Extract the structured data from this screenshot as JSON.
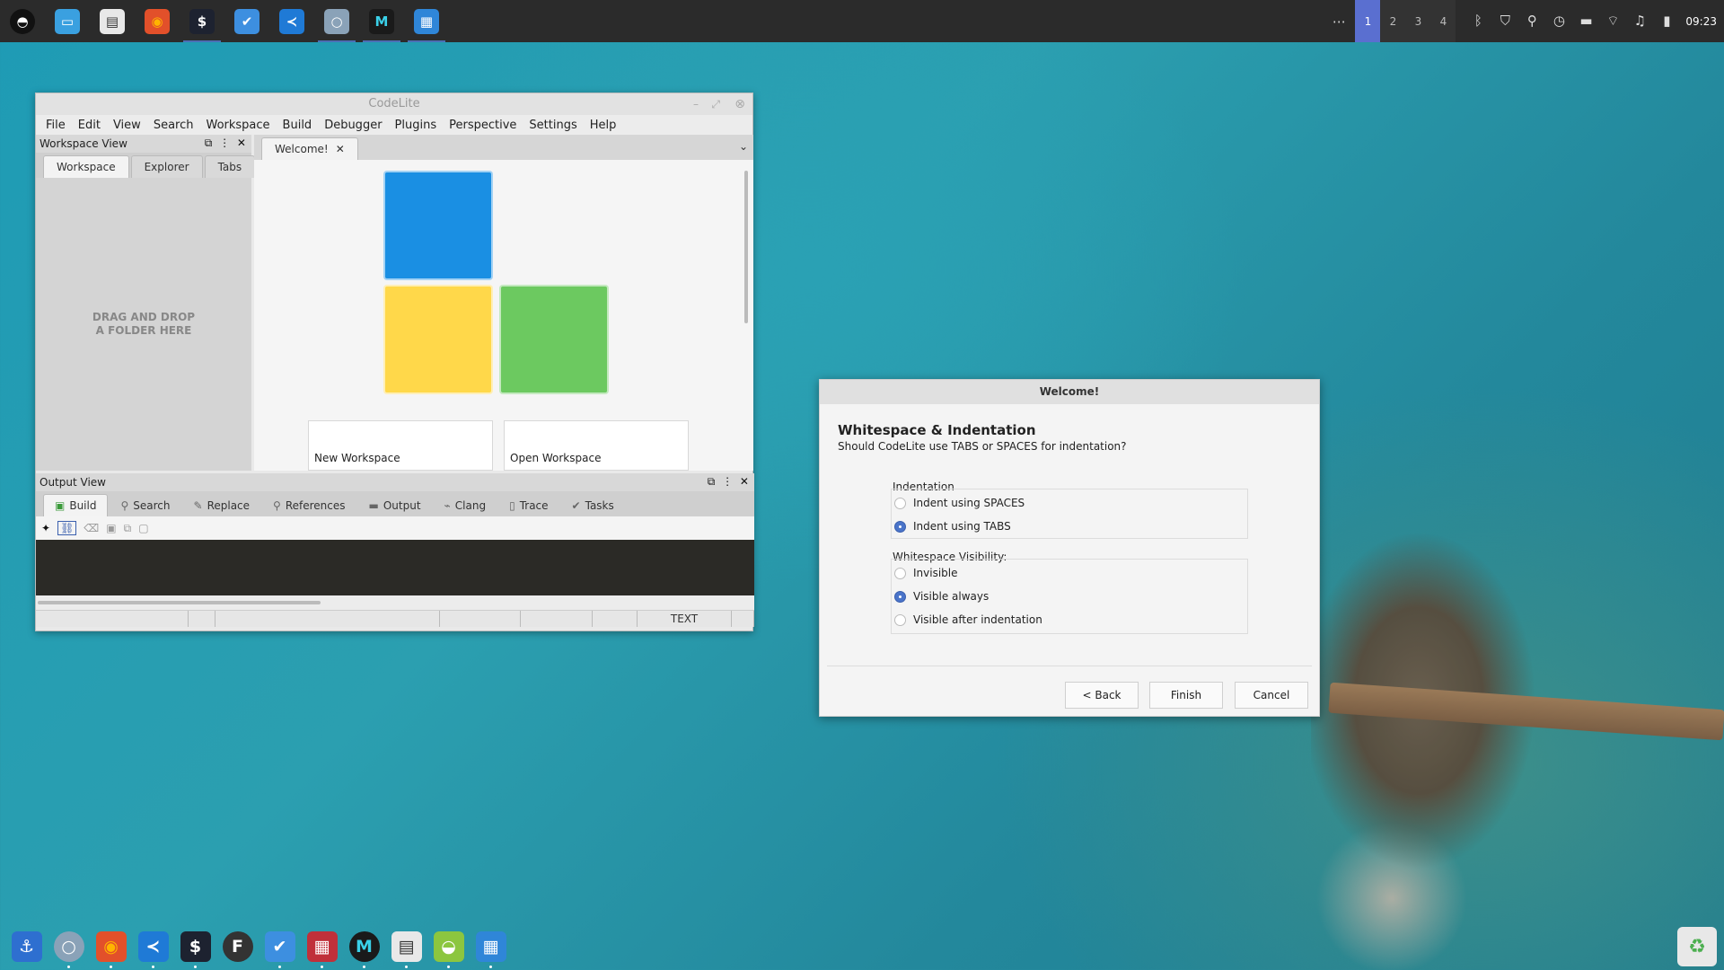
{
  "top_panel": {
    "apps": [
      {
        "name": "launcher-icon",
        "glyph": "◓",
        "color": "#ffffff",
        "bg": "#111111"
      },
      {
        "name": "files-icon",
        "glyph": "▭",
        "color": "#ffffff",
        "bg": "#3aa0e0"
      },
      {
        "name": "archive-icon",
        "glyph": "▤",
        "color": "#333333",
        "bg": "#e8e8e8"
      },
      {
        "name": "firefox-icon",
        "glyph": "◉",
        "color": "#ffb400",
        "bg": "#e2502a"
      },
      {
        "name": "terminal-icon",
        "glyph": "$",
        "color": "#ffffff",
        "bg": "#1d2230"
      },
      {
        "name": "tasks-icon",
        "glyph": "✔",
        "color": "#ffffff",
        "bg": "#3d8fe0"
      },
      {
        "name": "vscode-icon",
        "glyph": "≺",
        "color": "#ffffff",
        "bg": "#1f7ad6"
      },
      {
        "name": "browser-icon",
        "glyph": "○",
        "color": "#ffffff",
        "bg": "#8aa2b8"
      },
      {
        "name": "mail-icon",
        "glyph": "M",
        "color": "#3ad0e8",
        "bg": "#1a1a1a"
      },
      {
        "name": "boxes-icon",
        "glyph": "▦",
        "color": "#ffffff",
        "bg": "#2f86d8"
      }
    ],
    "workspaces": [
      "1",
      "2",
      "3",
      "4"
    ],
    "active_workspace": "1",
    "overflow_label": "⋯",
    "tray": [
      {
        "name": "bluetooth-icon",
        "glyph": "ᛒ"
      },
      {
        "name": "shield-icon",
        "glyph": "⛉"
      },
      {
        "name": "location-icon",
        "glyph": "⚲"
      },
      {
        "name": "clock-icon",
        "glyph": "◷"
      },
      {
        "name": "flag-us-icon",
        "glyph": "▬"
      },
      {
        "name": "wifi-icon",
        "glyph": "⌔"
      },
      {
        "name": "music-icon",
        "glyph": "♫"
      },
      {
        "name": "battery-icon",
        "glyph": "▮"
      }
    ],
    "time": "09:23"
  },
  "codelite": {
    "title": "CodeLite",
    "menu": [
      "File",
      "Edit",
      "View",
      "Search",
      "Workspace",
      "Build",
      "Debugger",
      "Plugins",
      "Perspective",
      "Settings",
      "Help"
    ],
    "workspace_view": {
      "title": "Workspace View",
      "tabs": [
        "Workspace",
        "Explorer",
        "Tabs"
      ],
      "drop_line1": "DRAG AND DROP",
      "drop_line2": "A FOLDER HERE"
    },
    "editor": {
      "tab": "Welcome!",
      "new_workspace": "New Workspace",
      "open_workspace": "Open Workspace"
    },
    "output_view": {
      "title": "Output View",
      "tabs": [
        "Build",
        "Search",
        "Replace",
        "References",
        "Output",
        "Clang",
        "Trace",
        "Tasks"
      ]
    },
    "status": [
      "",
      "",
      "",
      "",
      "",
      "",
      "TEXT",
      ""
    ]
  },
  "dialog": {
    "title": "Welcome!",
    "heading": "Whitespace & Indentation",
    "subheading": "Should CodeLite use TABS or SPACES for indentation?",
    "indentation_label": "Indentation",
    "indent_options": [
      "Indent using SPACES",
      "Indent using TABS"
    ],
    "indent_selected": "Indent using TABS",
    "visibility_label": "Whitespace Visibility:",
    "visibility_options": [
      "Invisible",
      "Visible always",
      "Visible after indentation"
    ],
    "visibility_selected": "Visible always",
    "buttons": {
      "back": "< Back",
      "finish": "Finish",
      "cancel": "Cancel"
    }
  },
  "dock": [
    {
      "name": "anchor-icon",
      "glyph": "⚓",
      "color": "#ffffff",
      "bg": "#2e6fd0"
    },
    {
      "name": "browser-icon",
      "glyph": "○",
      "color": "#ffffff",
      "bg": "#8aa2b8"
    },
    {
      "name": "firefox-icon",
      "glyph": "◉",
      "color": "#ffb400",
      "bg": "#e2502a"
    },
    {
      "name": "vscode-icon",
      "glyph": "≺",
      "color": "#ffffff",
      "bg": "#1f7ad6"
    },
    {
      "name": "terminal-icon",
      "glyph": "$",
      "color": "#ffffff",
      "bg": "#1d2230"
    },
    {
      "name": "f-app-icon",
      "glyph": "F",
      "color": "#ffffff",
      "bg": "#333333"
    },
    {
      "name": "tasks-icon",
      "glyph": "✔",
      "color": "#ffffff",
      "bg": "#3d8fe0"
    },
    {
      "name": "grid-app-icon",
      "glyph": "▦",
      "color": "#ffffff",
      "bg": "#c0303a"
    },
    {
      "name": "mail-icon",
      "glyph": "M",
      "color": "#3ad0e8",
      "bg": "#1a1a1a"
    },
    {
      "name": "archive-icon",
      "glyph": "▤",
      "color": "#333333",
      "bg": "#e8e8e8"
    },
    {
      "name": "disk-icon",
      "glyph": "◒",
      "color": "#ffffff",
      "bg": "#8cc63f"
    },
    {
      "name": "boxes-icon",
      "glyph": "▦",
      "color": "#ffffff",
      "bg": "#2f86d8"
    }
  ],
  "trash": {
    "name": "trash-icon",
    "glyph": "♻"
  }
}
